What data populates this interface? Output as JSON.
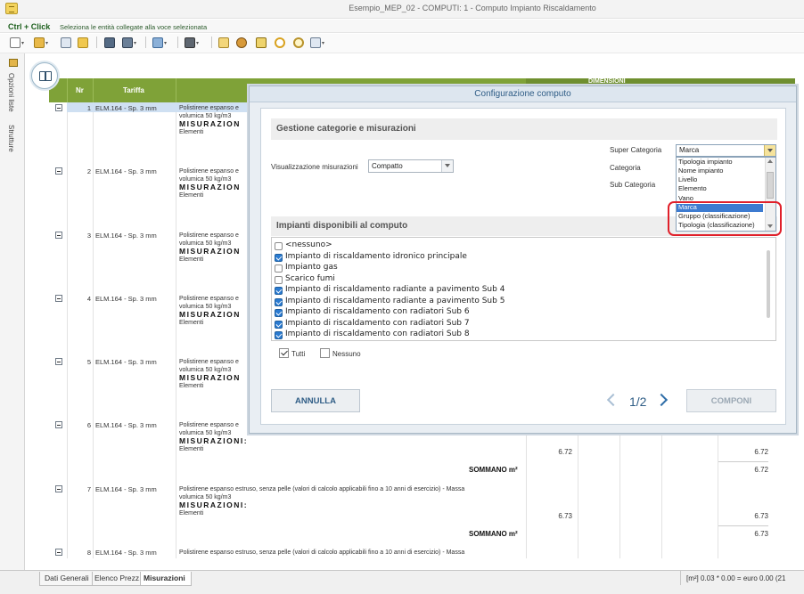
{
  "window": {
    "title": "Esempio_MEP_02 -  COMPUTI: 1 - Computo Impianto Riscaldamento"
  },
  "hint": {
    "key": "Ctrl + Click",
    "text": "Seleziona le entità collegate alla voce selezionata"
  },
  "left_tabs": {
    "opzioni": "Opzioni liste",
    "strutture": "Strutture"
  },
  "grid": {
    "headers": {
      "nr": "Nr",
      "tariffa": "Tariffa",
      "dimensioni": "DIMENSIONI"
    },
    "rows": [
      {
        "nr": "1",
        "tariffa": "ELM.164 - Sp. 3 mm",
        "desc1": "Polistirene espanso e",
        "desc2": "volumica 50 kg/m3",
        "misurazioni": "MISURAZION",
        "elementi": "Elementi"
      },
      {
        "nr": "2",
        "tariffa": "ELM.164 - Sp. 3 mm",
        "desc1": "Polistirene espanso e",
        "desc2": "volumica 50 kg/m3",
        "misurazioni": "MISURAZION",
        "elementi": "Elementi"
      },
      {
        "nr": "3",
        "tariffa": "ELM.164 - Sp. 3 mm",
        "desc1": "Polistirene espanso e",
        "desc2": "volumica 50 kg/m3",
        "misurazioni": "MISURAZION",
        "elementi": "Elementi"
      },
      {
        "nr": "4",
        "tariffa": "ELM.164 - Sp. 3 mm",
        "desc1": "Polistirene espanso e",
        "desc2": "volumica 50 kg/m3",
        "misurazioni": "MISURAZION",
        "elementi": "Elementi"
      },
      {
        "nr": "5",
        "tariffa": "ELM.164 - Sp. 3 mm",
        "desc1": "Polistirene espanso e",
        "desc2": "volumica 50 kg/m3",
        "misurazioni": "MISURAZION",
        "elementi": "Elementi"
      },
      {
        "nr": "6",
        "tariffa": "ELM.164 - Sp. 3 mm",
        "desc1": "Polistirene espanso e",
        "desc2": "volumica 50 kg/m3",
        "misurazioni": "MISURAZIONI:",
        "elementi": "Elementi",
        "val1": "6.72",
        "val2": "6.72",
        "sommano": "SOMMANO m²",
        "somm_val": "6.72"
      },
      {
        "nr": "7",
        "tariffa": "ELM.164 - Sp. 3 mm",
        "desc1": "Polistirene espanso estruso, senza  pelle (valori di calcolo applicabili fino a  10 anni di esercizio) - Massa",
        "desc2": "volumica 50 kg/m3",
        "misurazioni": "MISURAZIONI:",
        "elementi": "Elementi",
        "val1": "6.73",
        "val2": "6.73",
        "sommano": "SOMMANO m²",
        "somm_val": "6.73"
      },
      {
        "nr": "8",
        "tariffa": "ELM.164 - Sp. 3 mm",
        "desc1": "Polistirene espanso estruso, senza  pelle (valori di calcolo applicabili fino a  10 anni di esercizio) - Massa"
      }
    ]
  },
  "bottom_tabs": [
    "Dati Generali",
    "Elenco Prezz...",
    "Misurazioni"
  ],
  "status": "[m²] 0.03 * 0.00 = euro 0.00  (21",
  "dialog": {
    "title": "Configurazione computo",
    "section1": "Gestione categorie e misurazioni",
    "vis_label": "Visualizzazione misurazioni",
    "vis_value": "Compatto",
    "super_label": "Super Categoria",
    "cat_label": "Categoria",
    "subcat_label": "Sub Categoria",
    "super_value": "Marca",
    "dropdown_items": [
      "Tipologia impianto",
      "Nome impianto",
      "Livello",
      "Elemento",
      "Vano",
      "Marca",
      "Gruppo (classificazione)",
      "Tipologia (classificazione)"
    ],
    "dropdown_selected": "Marca",
    "section2": "Impianti disponibili al computo",
    "impianti": [
      {
        "label": "<nessuno>",
        "checked": false
      },
      {
        "label": "Impianto di riscaldamento idronico principale",
        "checked": true
      },
      {
        "label": "Impianto gas",
        "checked": false
      },
      {
        "label": "Scarico fumi",
        "checked": false
      },
      {
        "label": "Impianto di riscaldamento radiante a pavimento Sub 4",
        "checked": true
      },
      {
        "label": "Impianto di riscaldamento radiante a pavimento Sub 5",
        "checked": true
      },
      {
        "label": "Impianto di riscaldamento con radiatori Sub 6",
        "checked": true
      },
      {
        "label": "Impianto di riscaldamento con radiatori Sub 7",
        "checked": true
      },
      {
        "label": "Impianto di riscaldamento con radiatori Sub 8",
        "checked": true
      }
    ],
    "tutti": "Tutti",
    "nessuno": "Nessuno",
    "annulla": "ANNULLA",
    "page": "1/2",
    "componi": "COMPONI"
  },
  "colors": {
    "grid_header": "#7fa238",
    "dialog_accent": "#2f5d86",
    "highlight": "#e0202a"
  }
}
